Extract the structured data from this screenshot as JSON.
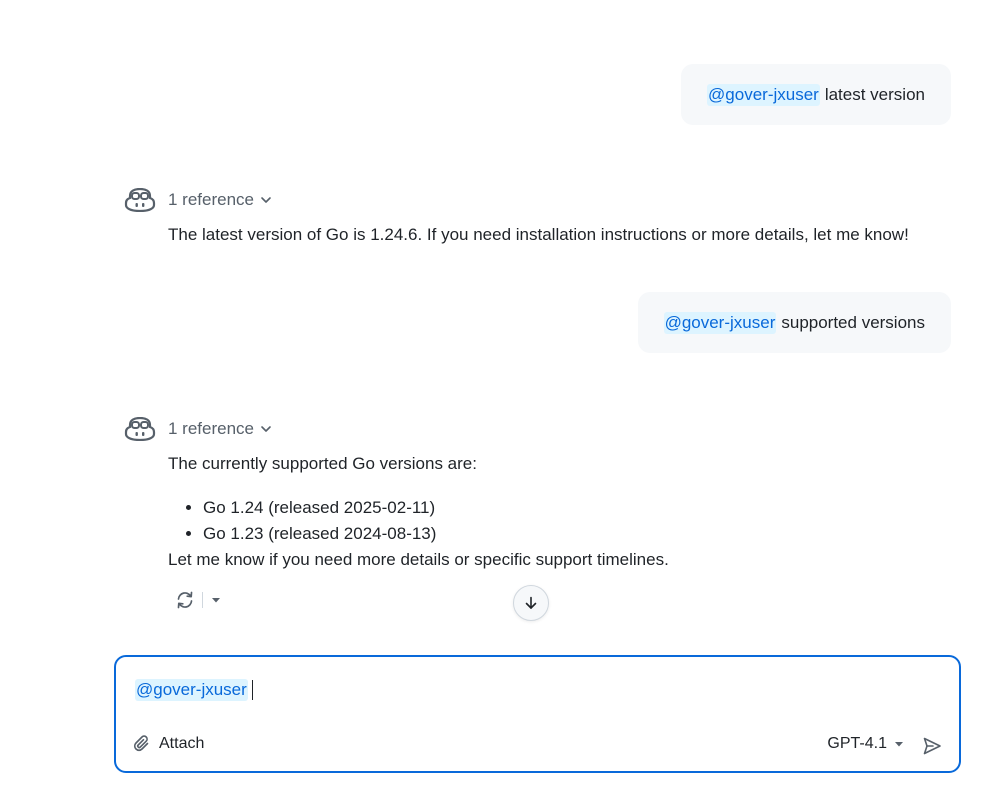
{
  "conversation": {
    "user_messages": [
      {
        "mention": "@gover-jxuser",
        "text": "latest version"
      },
      {
        "mention": "@gover-jxuser",
        "text": "supported versions"
      }
    ],
    "assistant_messages": [
      {
        "reference_label": "1 reference",
        "text": "The latest version of Go is 1.24.6. If you need installation instructions or more details, let me know!"
      },
      {
        "reference_label": "1 reference",
        "intro": "The currently supported Go versions are:",
        "list": [
          "Go 1.24 (released 2025-02-11)",
          "Go 1.23 (released 2024-08-13)"
        ],
        "outro": "Let me know if you need more details or specific support timelines."
      }
    ]
  },
  "icons": {
    "avatar": "copilot-icon",
    "chevron": "chevron-down-icon",
    "retry": "sync-icon",
    "scroll_down": "arrow-down-icon",
    "attach": "paperclip-icon",
    "send": "paper-airplane-icon"
  },
  "composer": {
    "mention": "@gover-jxuser",
    "attach_label": "Attach",
    "model_label": "GPT-4.1"
  },
  "colors": {
    "accent": "#0969da",
    "mention_bg": "#ddf4ff",
    "bubble_bg": "#f6f8fa"
  }
}
